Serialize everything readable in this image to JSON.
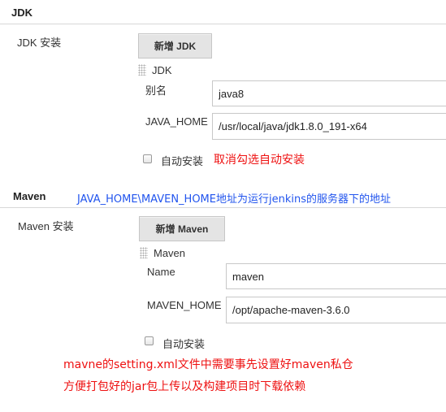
{
  "jdk": {
    "section_title": "JDK",
    "install_label": "JDK 安装",
    "add_button": "新增 JDK",
    "item_title": "JDK",
    "name_label": "别名",
    "name_value": "java8",
    "home_label": "JAVA_HOME",
    "home_value": "/usr/local/java/jdk1.8.0_191-x64",
    "auto_install_label": "自动安装",
    "annotation": "取消勾选自动安装"
  },
  "maven": {
    "section_title": "Maven",
    "section_annotation": "JAVA_HOME\\MAVEN_HOME地址为运行jenkins的服务器下的地址",
    "install_label": "Maven 安装",
    "add_button": "新增 Maven",
    "item_title": "Maven",
    "name_label": "Name",
    "name_value": "maven",
    "home_label": "MAVEN_HOME",
    "home_value": "/opt/apache-maven-3.6.0",
    "auto_install_label": "自动安装",
    "annotation_line1": "mavne的setting.xml文件中需要事先设置好maven私仓",
    "annotation_line2": "方便打包好的jar包上传以及构建项目时下载依赖"
  },
  "colors": {
    "annotation_red": "#ee1111",
    "annotation_blue": "#2255ee",
    "button_bg": "#e4e4e4"
  }
}
